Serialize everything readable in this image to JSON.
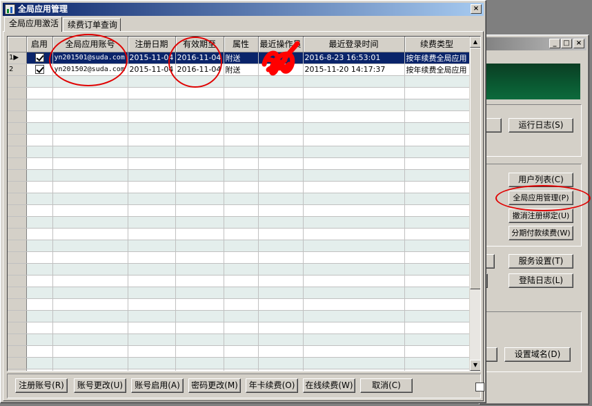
{
  "back_window": {
    "buttons": {
      "run_log": "运行日志(S)",
      "user_list": "用户列表(C)",
      "global_app_manage": "全局应用管理(P)",
      "cancel_binding": "撤消注册绑定(U)",
      "installment_renew": "分期付款续费(W)",
      "service_settings": "服务设置(T)",
      "login_log": "登陆日志(L)",
      "set_domain": "设置域名(D)"
    },
    "accent": "#0a5a32"
  },
  "dialog": {
    "title": "全局应用管理",
    "close_label": "×",
    "tabs": [
      {
        "label": "全局应用激活",
        "active": true
      },
      {
        "label": "续费订单查询",
        "active": false
      }
    ],
    "grid": {
      "columns": [
        "启用",
        "全局应用账号",
        "注册日期",
        "有效期至",
        "属性",
        "最近操作员",
        "最近登录时间",
        "续费类型"
      ],
      "rows": [
        {
          "num": "1",
          "enabled": true,
          "account": "yn201501@suda.com",
          "reg_date": "2015-11-04",
          "expire": "2016-11-04",
          "attr": "附送",
          "operator": "",
          "last_login": "2016-8-23 16:53:01",
          "renew_type": "按年续费全局应用",
          "selected": true
        },
        {
          "num": "2",
          "enabled": true,
          "account": "yn201502@suda.com",
          "reg_date": "2015-11-04",
          "expire": "2016-11-04",
          "attr": "附送",
          "operator": "",
          "last_login": "2015-11-20 14:17:37",
          "renew_type": "按年续费全局应用",
          "selected": false
        }
      ]
    },
    "buttons": {
      "register": "注册账号(R)",
      "modify": "账号更改(U)",
      "enable": "账号启用(A)",
      "password": "密码更改(M)",
      "annual": "年卡续费(O)",
      "online": "在线续费(W)",
      "cancel": "取消(C)"
    }
  }
}
